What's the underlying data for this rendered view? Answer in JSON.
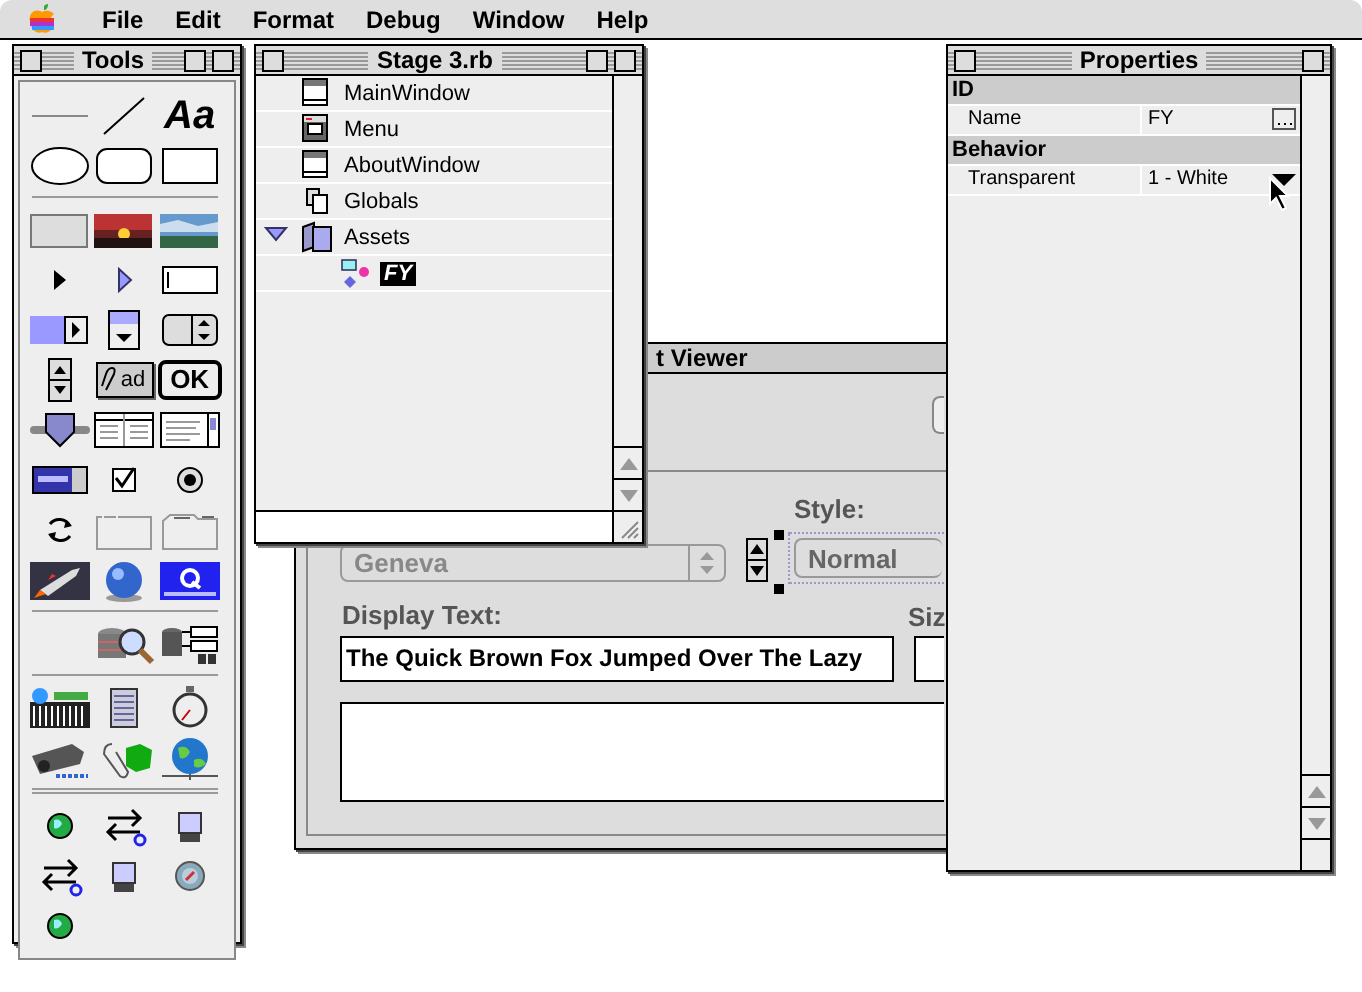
{
  "menu_bar": {
    "items": [
      "File",
      "Edit",
      "Format",
      "Debug",
      "Window",
      "Help"
    ]
  },
  "tools_window": {
    "title": "Tools",
    "text_tool_label": "Aa",
    "bevel_tool_label": "ad",
    "button_tool_label": "OK"
  },
  "project_window": {
    "title": "Stage 3.rb",
    "items": [
      {
        "label": "MainWindow",
        "kind": "window",
        "selected": false
      },
      {
        "label": "Menu",
        "kind": "menu",
        "selected": false
      },
      {
        "label": "AboutWindow",
        "kind": "window",
        "selected": false
      },
      {
        "label": "Globals",
        "kind": "module",
        "selected": false
      },
      {
        "label": "Assets",
        "kind": "folder",
        "selected": false,
        "expanded": true,
        "children": [
          {
            "label": "FY",
            "kind": "picture",
            "selected": true
          }
        ]
      }
    ]
  },
  "viewer_window": {
    "title": "t Viewer",
    "font_popup": {
      "value": "Geneva",
      "disabled": true
    },
    "style_label": "Style:",
    "style_popup": {
      "value": "Normal",
      "selected": true
    },
    "display_text_label": "Display Text:",
    "display_text_field": {
      "value": "The Quick Brown Fox Jumped Over The Lazy"
    },
    "size_label": "Siz"
  },
  "properties_window": {
    "title": "Properties",
    "sections": [
      {
        "heading": "ID",
        "rows": [
          {
            "name": "Name",
            "value": "FY",
            "kind": "button"
          }
        ]
      },
      {
        "heading": "Behavior",
        "rows": [
          {
            "name": "Transparent",
            "value": "1 - White",
            "kind": "menu"
          }
        ]
      }
    ]
  }
}
